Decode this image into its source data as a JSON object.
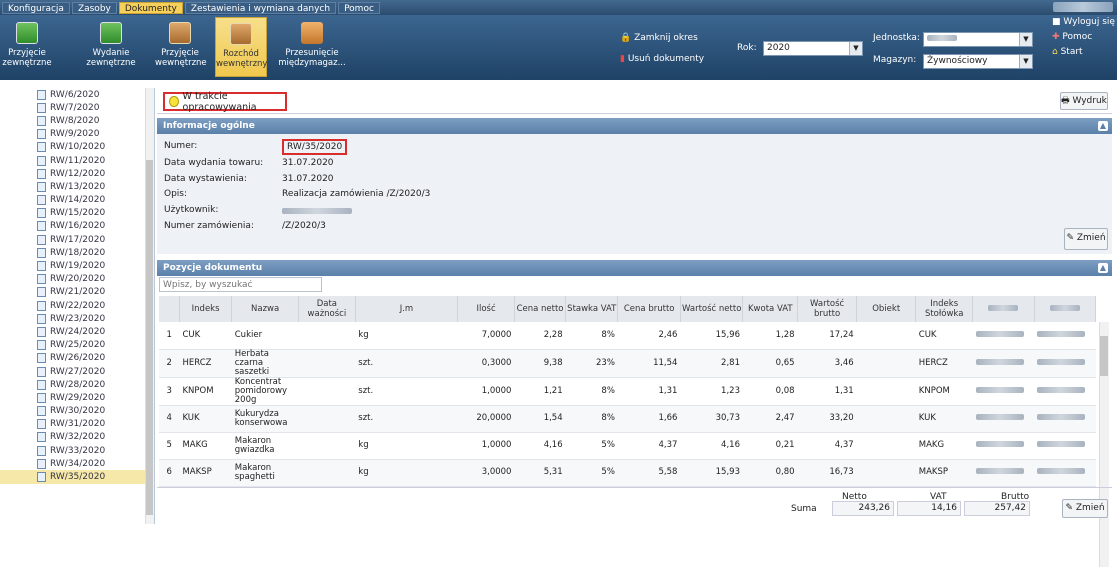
{
  "menu": [
    "Konfiguracja",
    "Zasoby",
    "Dokumenty",
    "Zestawienia i wymiana danych",
    "Pomoc"
  ],
  "toolbar": {
    "buttons": [
      "Przyjęcie zewnętrzne",
      "Wydanie zewnętrzne",
      "Przyjęcie wewnętrzne",
      "Rozchód wewnętrzny",
      "Przesunięcie międzymagaz..."
    ],
    "zamknij": "Zamknij okres",
    "usun": "Usuń dokumenty",
    "rok_label": "Rok:",
    "rok": "2020",
    "jednostka_label": "Jednostka:",
    "magazyn_label": "Magazyn:",
    "magazyn": "Żywnościowy",
    "wyloguj": "Wyloguj się",
    "pomoc": "Pomoc",
    "start": "Start"
  },
  "tree": [
    "RW/6/2020",
    "RW/7/2020",
    "RW/8/2020",
    "RW/9/2020",
    "RW/10/2020",
    "RW/11/2020",
    "RW/12/2020",
    "RW/13/2020",
    "RW/14/2020",
    "RW/15/2020",
    "RW/16/2020",
    "RW/17/2020",
    "RW/18/2020",
    "RW/19/2020",
    "RW/20/2020",
    "RW/21/2020",
    "RW/22/2020",
    "RW/23/2020",
    "RW/24/2020",
    "RW/25/2020",
    "RW/26/2020",
    "RW/27/2020",
    "RW/28/2020",
    "RW/29/2020",
    "RW/30/2020",
    "RW/31/2020",
    "RW/32/2020",
    "RW/33/2020",
    "RW/34/2020",
    "RW/35/2020"
  ],
  "status": "W trakcie opracowywania",
  "wydruk": "Wydruk",
  "info": {
    "header": "Informacje ogólne",
    "numer_l": "Numer:",
    "numer": "RW/35/2020",
    "data_wyd_l": "Data wydania towaru:",
    "data_wyd": "31.07.2020",
    "data_wyst_l": "Data wystawienia:",
    "data_wyst": "31.07.2020",
    "opis_l": "Opis:",
    "opis": "Realizacja zamówienia /Z/2020/3",
    "uzytk_l": "Użytkownik:",
    "zam_l": "Numer zamówienia:",
    "zam": "/Z/2020/3",
    "zmien": "Zmień"
  },
  "items": {
    "header": "Pozycje dokumentu",
    "search_placeholder": "Wpisz, by wyszukać",
    "columns": [
      "",
      "Indeks",
      "Nazwa",
      "Data ważności",
      "J.m",
      "Ilość",
      "Cena netto",
      "Stawka VAT",
      "Cena brutto",
      "Wartość netto",
      "Kwota VAT",
      "Wartość brutto",
      "Obiekt",
      "Indeks Stołówka"
    ],
    "rows": [
      [
        "1",
        "CUK",
        "Cukier",
        "",
        "kg",
        "7,0000",
        "2,28",
        "8%",
        "2,46",
        "15,96",
        "1,28",
        "17,24",
        "",
        "CUK"
      ],
      [
        "2",
        "HERCZ",
        "Herbata czarna saszetki",
        "",
        "szt.",
        "0,3000",
        "9,38",
        "23%",
        "11,54",
        "2,81",
        "0,65",
        "3,46",
        "",
        "HERCZ"
      ],
      [
        "3",
        "KNPOM",
        "Koncentrat pomidorowy 200g",
        "",
        "szt.",
        "1,0000",
        "1,21",
        "8%",
        "1,31",
        "1,23",
        "0,08",
        "1,31",
        "",
        "KNPOM"
      ],
      [
        "4",
        "KUK",
        "Kukurydza konserwowa",
        "",
        "szt.",
        "20,0000",
        "1,54",
        "8%",
        "1,66",
        "30,73",
        "2,47",
        "33,20",
        "",
        "KUK"
      ],
      [
        "5",
        "MAKG",
        "Makaron gwiazdka",
        "",
        "kg",
        "1,0000",
        "4,16",
        "5%",
        "4,37",
        "4,16",
        "0,21",
        "4,37",
        "",
        "MAKG"
      ],
      [
        "6",
        "MAKSP",
        "Makaron spaghetti",
        "",
        "kg",
        "3,0000",
        "5,31",
        "5%",
        "5,58",
        "15,93",
        "0,80",
        "16,73",
        "",
        "MAKSP"
      ]
    ]
  },
  "sum": {
    "label": "Suma",
    "netto_l": "Netto",
    "vat_l": "VAT",
    "brutto_l": "Brutto",
    "netto": "243,26",
    "vat": "14,16",
    "brutto": "257,42",
    "zmien": "Zmień"
  }
}
